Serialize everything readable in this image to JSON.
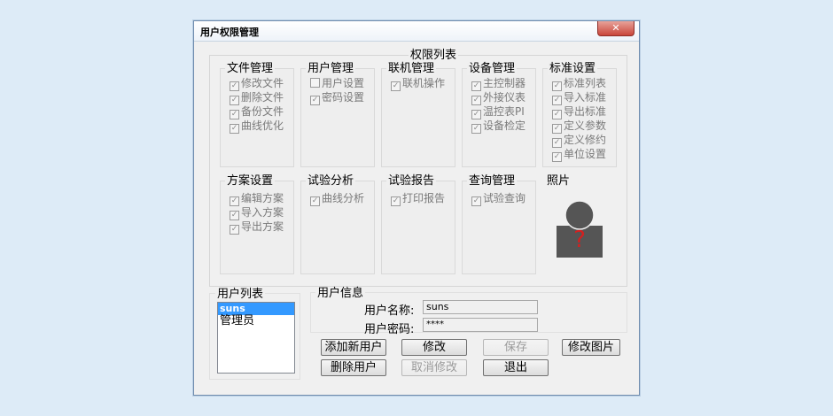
{
  "window": {
    "title": "用户权限管理",
    "close_label": "✕"
  },
  "permissions": {
    "title": "权限列表",
    "groups": [
      {
        "label": "文件管理",
        "items": [
          "修改文件",
          "删除文件",
          "备份文件",
          "曲线优化"
        ]
      },
      {
        "label": "用户管理",
        "items": [
          "用户设置",
          "密码设置"
        ]
      },
      {
        "label": "联机管理",
        "items": [
          "联机操作"
        ]
      },
      {
        "label": "设备管理",
        "items": [
          "主控制器",
          "外接仪表",
          "温控表PI",
          "设备检定"
        ]
      },
      {
        "label": "标准设置",
        "items": [
          "标准列表",
          "导入标准",
          "导出标准",
          "定义参数",
          "定义修约",
          "单位设置"
        ]
      },
      {
        "label": "方案设置",
        "items": [
          "编辑方案",
          "导入方案",
          "导出方案"
        ]
      },
      {
        "label": "试验分析",
        "items": [
          "曲线分析"
        ]
      },
      {
        "label": "试验报告",
        "items": [
          "打印报告"
        ]
      },
      {
        "label": "查询管理",
        "items": [
          "试验查询"
        ]
      }
    ],
    "photo_label": "照片"
  },
  "user_list": {
    "title": "用户列表",
    "items": [
      "suns",
      "管理员"
    ],
    "selected": "suns"
  },
  "user_info": {
    "title": "用户信息",
    "name_label": "用户名称:",
    "name_value": "suns",
    "password_label": "用户密码:",
    "password_value": "****"
  },
  "buttons": {
    "add_user": "添加新用户",
    "modify": "修改",
    "save": "保存",
    "modify_photo": "修改图片",
    "delete_user": "删除用户",
    "cancel_modify": "取消修改",
    "exit": "退出"
  },
  "icons": {
    "photo": "unknown-person-icon",
    "photo_color": "#555555",
    "question_color": "#d32020"
  },
  "colors": {
    "selection": "#3399ff",
    "close_button": "#c9453a"
  }
}
